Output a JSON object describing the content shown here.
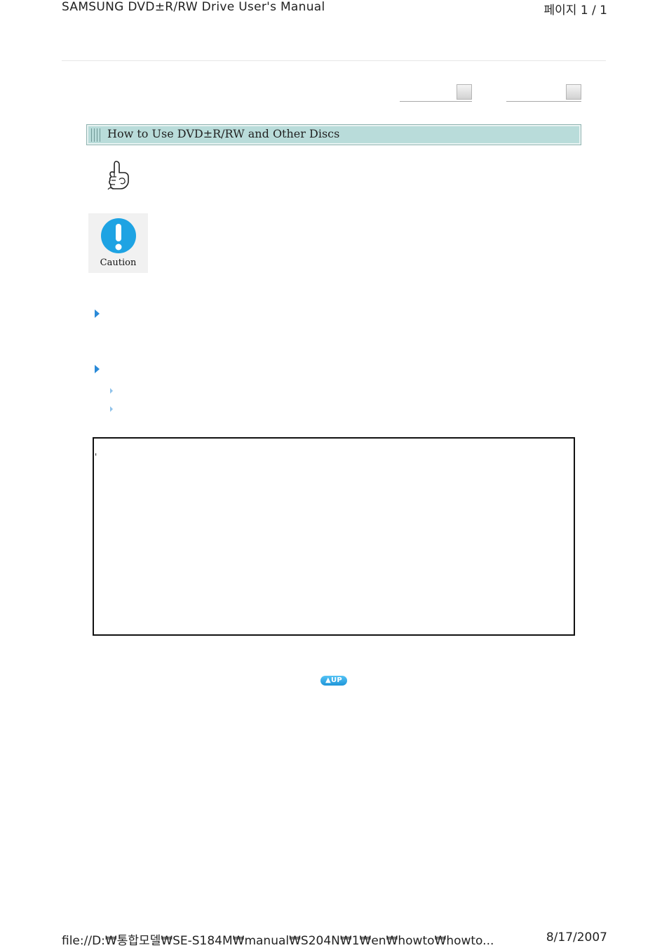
{
  "print_header": {
    "title": "SAMSUNG DVD±R/RW Drive User's Manual",
    "page_info": "페이지 1 / 1"
  },
  "navigation": {
    "prev_icon": "nav-box",
    "next_icon": "nav-box"
  },
  "section": {
    "title": "How to Use  DVD±R/RW and Other Discs"
  },
  "note": {
    "icon": "pointing-hand-icon"
  },
  "caution": {
    "icon": "exclamation-icon",
    "label": "Caution",
    "accent_color": "#1ea3e3"
  },
  "bullets": {
    "primary_color": "#2a8ad8",
    "secondary_color": "#8fc2ea"
  },
  "content_box": {
    "marker": "'"
  },
  "up_button": {
    "label": "▲UP"
  },
  "print_footer": {
    "path": "file://D:₩통합모델₩SE-S184M₩manual₩S204N₩1₩en₩howto₩howto...",
    "date": "8/17/2007"
  }
}
